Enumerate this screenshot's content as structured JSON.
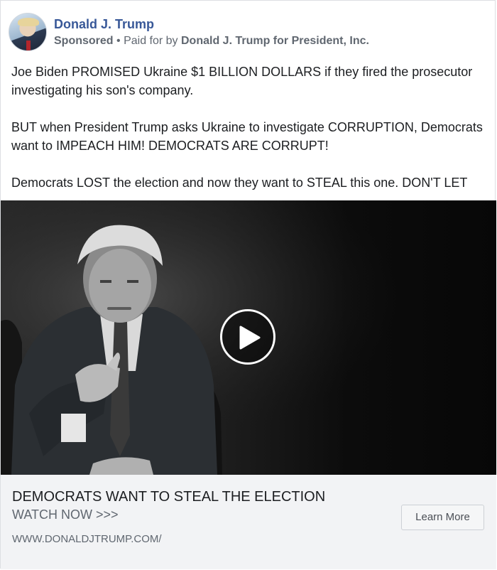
{
  "post": {
    "page_name": "Donald J. Trump",
    "sponsored_label": "Sponsored",
    "separator": " • ",
    "paid_for_prefix": "Paid for by ",
    "paid_for_entity": "Donald J. Trump for President, Inc.",
    "paragraphs": [
      "Joe Biden PROMISED Ukraine $1 BILLION DOLLARS if they fired the prosecutor investigating his son's company.",
      "BUT when President Trump asks Ukraine to investigate CORRUPTION, Democrats want to IMPEACH HIM! DEMOCRATS ARE CORRUPT!",
      "Democrats LOST the election and now they want to STEAL this one. DON'T LET"
    ]
  },
  "video": {
    "play_icon": "play-icon"
  },
  "cta": {
    "headline": "DEMOCRATS WANT TO STEAL THE ELECTION",
    "subtext": "WATCH NOW >>>",
    "url": "WWW.DONALDJTRUMP.COM/",
    "button_label": "Learn More"
  }
}
